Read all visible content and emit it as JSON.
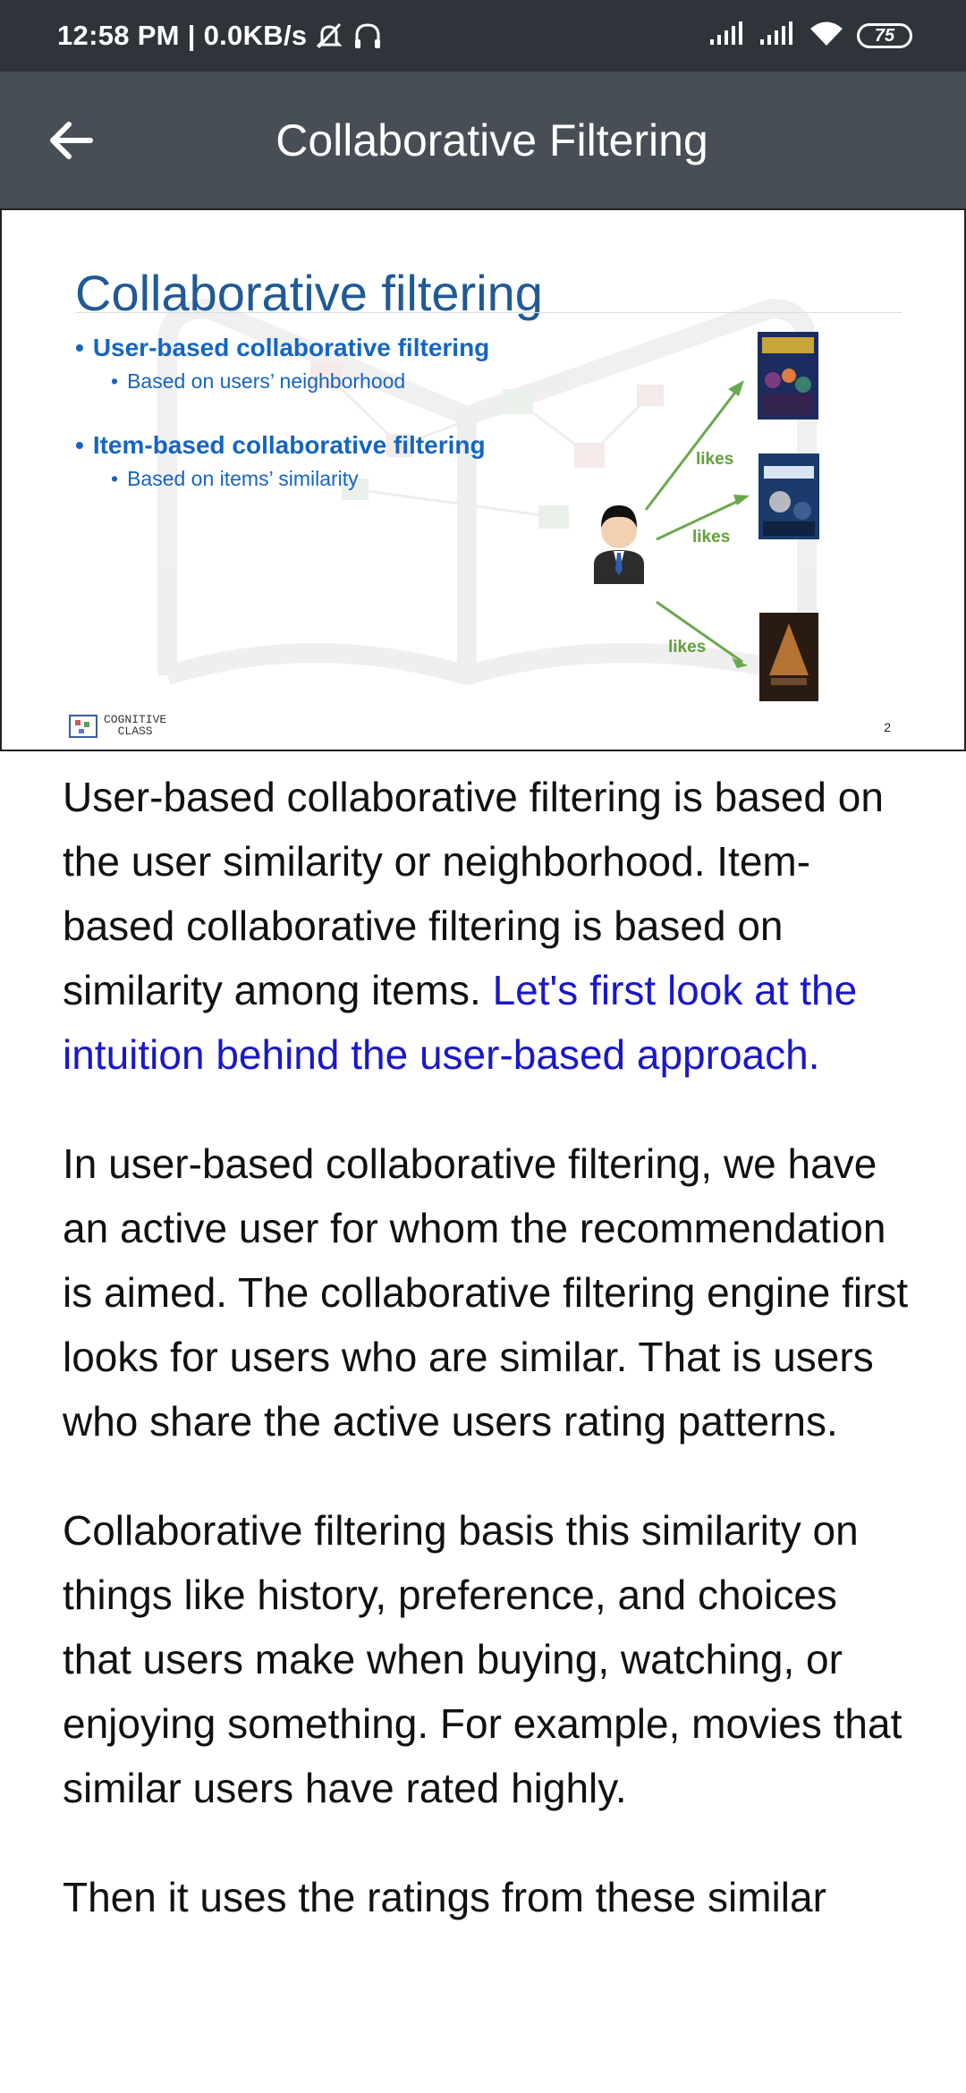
{
  "status_bar": {
    "time_speed": "12:58 PM | 0.0KB/s",
    "battery": "75"
  },
  "app_bar": {
    "title": "Collaborative Filtering"
  },
  "slide": {
    "title": "Collaborative filtering",
    "bullets": [
      {
        "main": "User-based collaborative filtering",
        "sub": "Based on users’ neighborhood"
      },
      {
        "main": "Item-based collaborative filtering",
        "sub": "Based on items’ similarity"
      }
    ],
    "likes_labels": [
      "likes",
      "likes",
      "likes"
    ],
    "logo_text_1": "COGNITIVE",
    "logo_text_2": "CLASS",
    "page_number": "2",
    "colors": {
      "title": "#1f5a96",
      "bullet": "#1565c0",
      "arrow": "#6aa84f"
    }
  },
  "article": {
    "p1_plain": "User-based collaborative filtering is based on the user similarity or neighborhood. Item-based collaborative filtering is based on similarity among items. ",
    "p1_highlight": "Let's first look at the intuition behind the user-based approach.",
    "p2": "In user-based collaborative filtering, we have an active user for whom the recommendation is aimed. The collaborative filtering engine first looks for users who are similar. That is users who share the active users rating patterns.",
    "p3": "Collaborative filtering basis this similarity on things like history, preference, and choices that users make when buying, watching, or enjoying something. For example, movies that similar users have rated highly.",
    "p4": "Then it uses the ratings from these similar"
  },
  "colors": {
    "status_bar": "#2f343a",
    "app_bar": "#474e56",
    "highlight_text": "#1a17c9"
  },
  "icons": [
    "mute-icon",
    "headset-icon",
    "signal-icon",
    "wifi-icon",
    "battery-icon",
    "back-arrow-icon",
    "user-icon"
  ]
}
